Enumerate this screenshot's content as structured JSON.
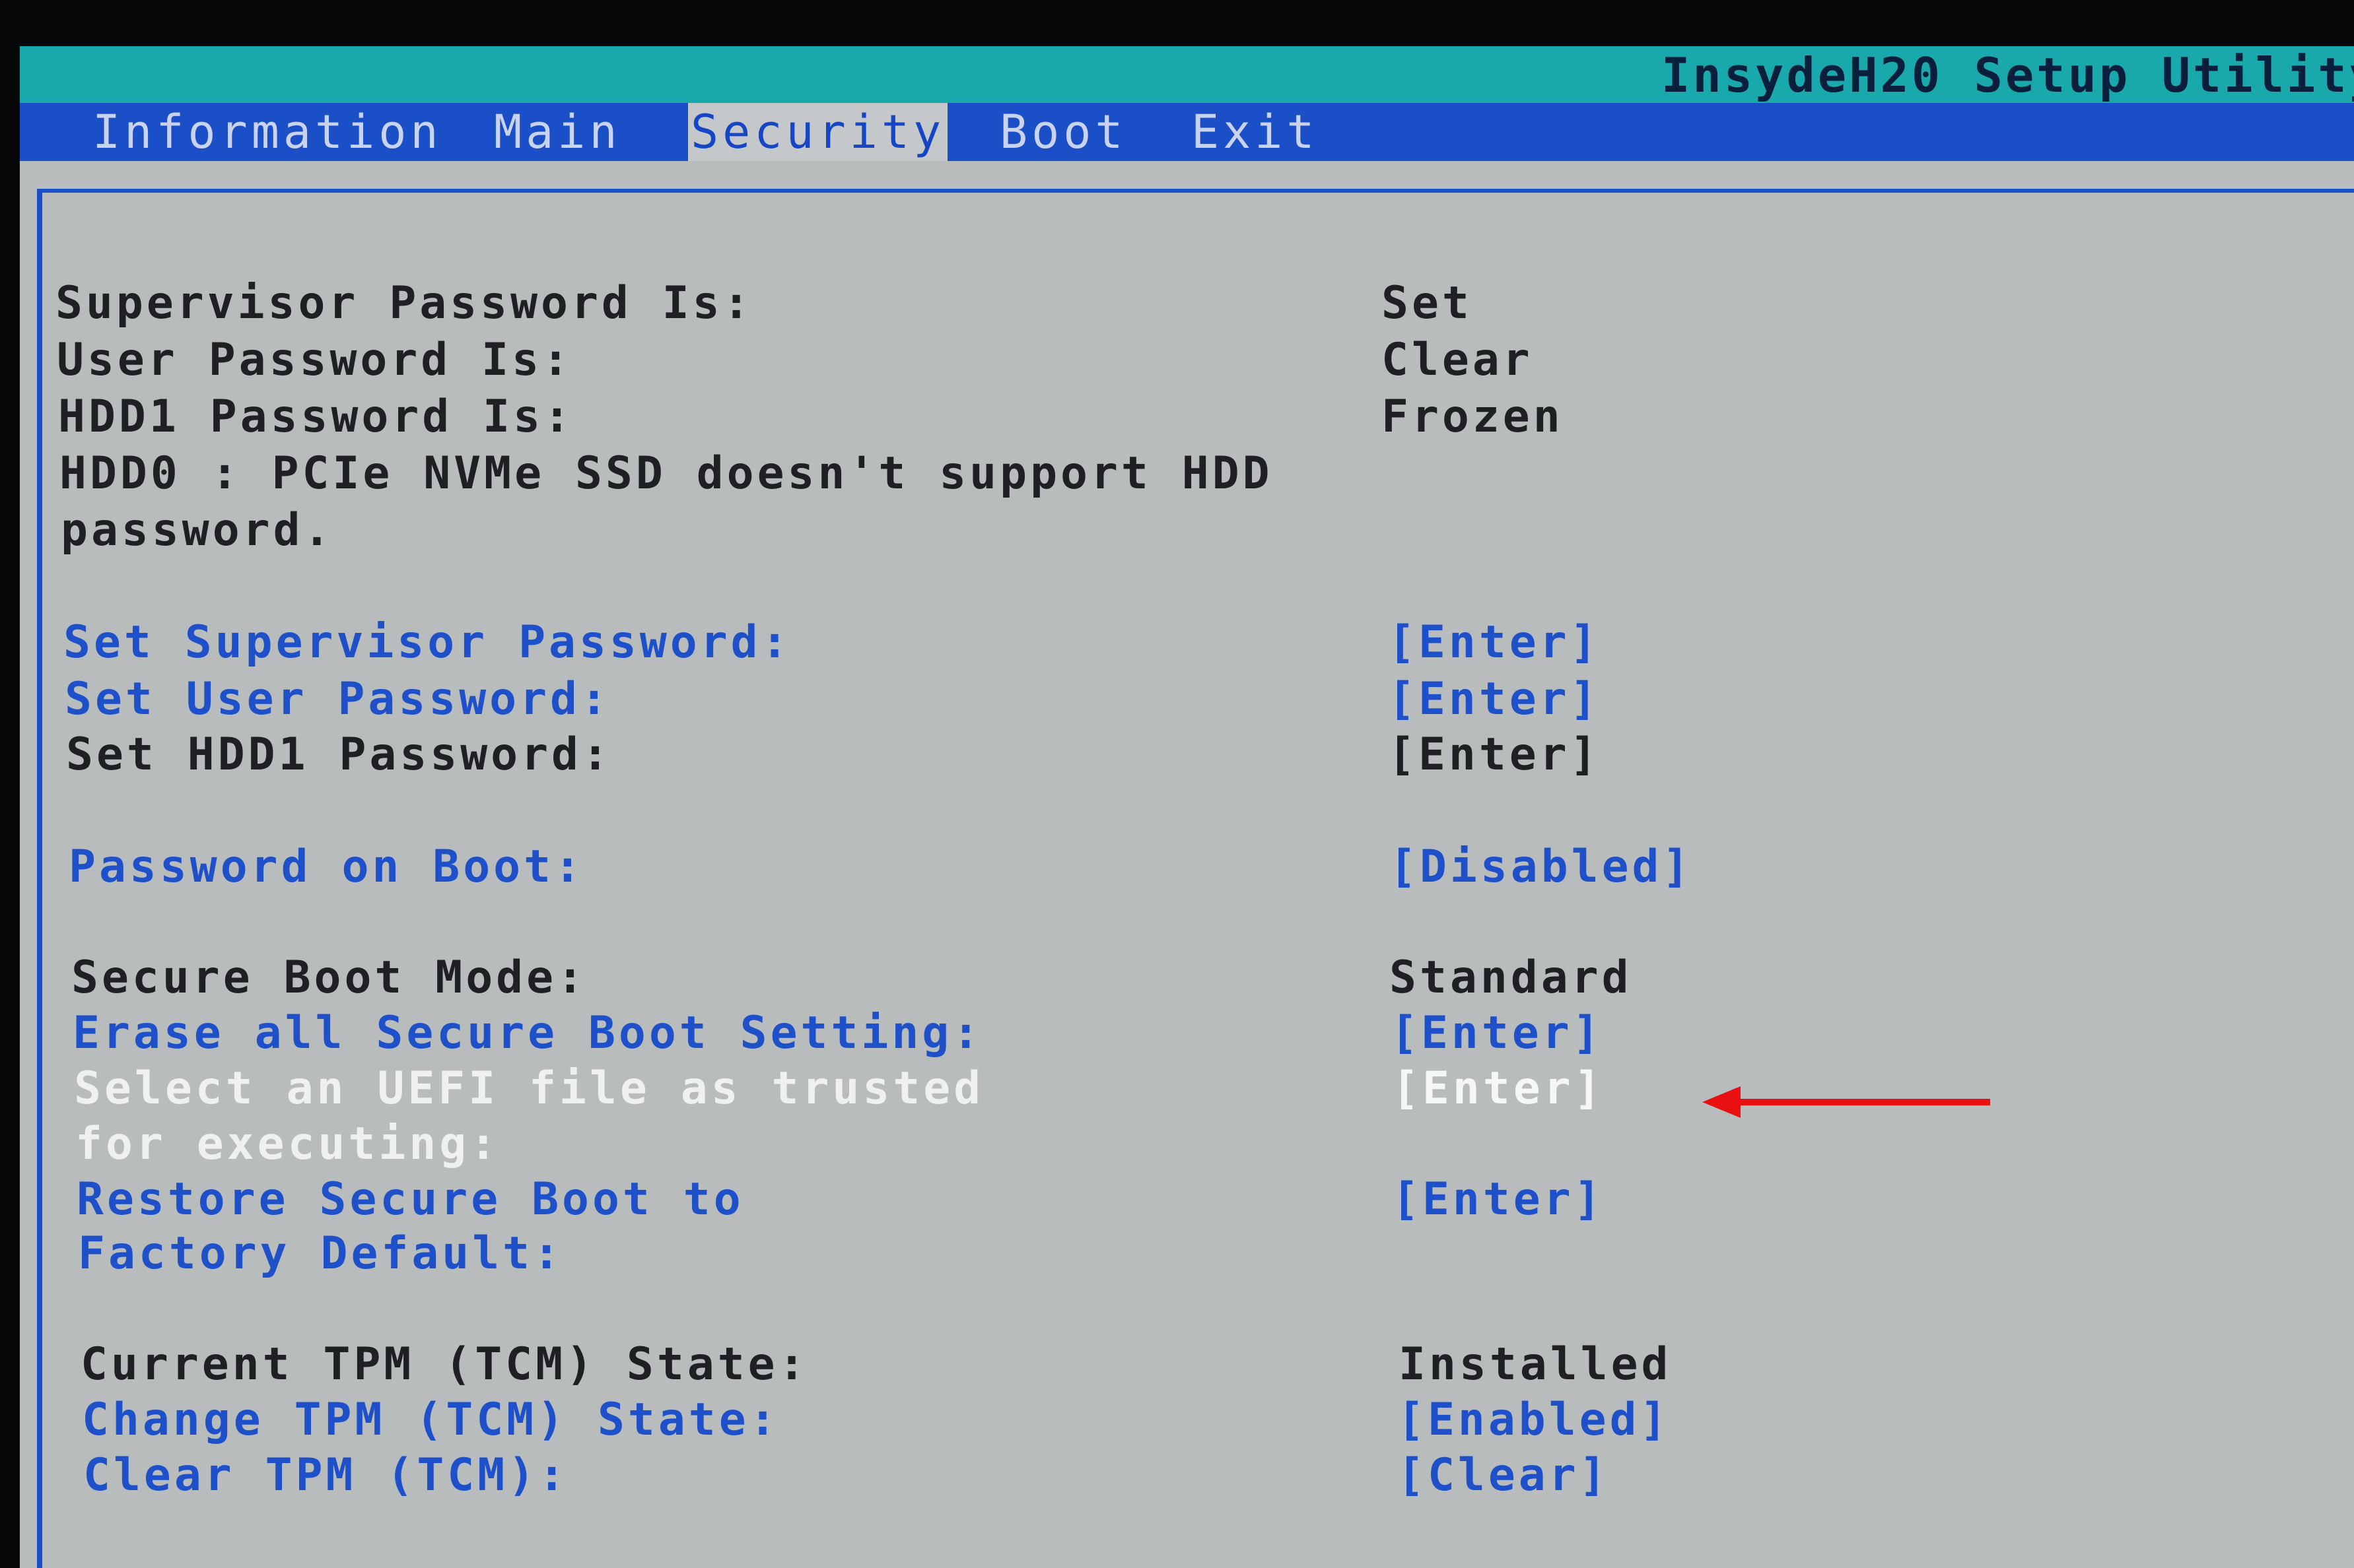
{
  "app_title": "InsydeH20 Setup Utility",
  "tabs": [
    {
      "label": "Information"
    },
    {
      "label": "Main"
    },
    {
      "label": "Security"
    },
    {
      "label": "Boot"
    },
    {
      "label": "Exit"
    }
  ],
  "active_tab": "Security",
  "security": {
    "status": [
      {
        "label": "Supervisor Password Is:",
        "value": "Set"
      },
      {
        "label": "User Password Is:",
        "value": "Clear"
      },
      {
        "label": "HDD1 Password Is:",
        "value": "Frozen"
      }
    ],
    "note_line1": "HDD0 : PCIe NVMe SSD doesn't support HDD",
    "note_line2": "password.",
    "password_settings": [
      {
        "label": "Set Supervisor Password:",
        "value": "[Enter]"
      },
      {
        "label": "Set User Password:",
        "value": "[Enter]"
      },
      {
        "label": "Set HDD1 Password:",
        "value": "[Enter]"
      }
    ],
    "password_on_boot": {
      "label": "Password on Boot:",
      "value": "[Disabled]"
    },
    "secure_boot_mode": {
      "label": "Secure Boot Mode:",
      "value": "Standard"
    },
    "erase_secure_boot": {
      "label": "Erase all Secure Boot Setting:",
      "value": "[Enter]"
    },
    "select_uefi": {
      "label_line1": "Select an UEFI file as trusted",
      "label_line2": "for executing:",
      "value": "[Enter]"
    },
    "restore_secure_boot": {
      "label_line1": "Restore Secure Boot to",
      "label_line2": "Factory Default:",
      "value": "[Enter]"
    },
    "tpm_current": {
      "label": "Current TPM (TCM) State:",
      "value": "Installed"
    },
    "tpm_change": {
      "label": "Change TPM (TCM) State:",
      "value": "[Enabled]"
    },
    "tpm_clear": {
      "label": "Clear TPM (TCM):",
      "value": "[Clear]"
    }
  },
  "colors": {
    "title_bar": "#19a9ad",
    "menu_bar": "#1a4fc8",
    "panel": "#b9bcbd",
    "link_text": "#1d50c9",
    "annotation_arrow": "#e81010"
  }
}
